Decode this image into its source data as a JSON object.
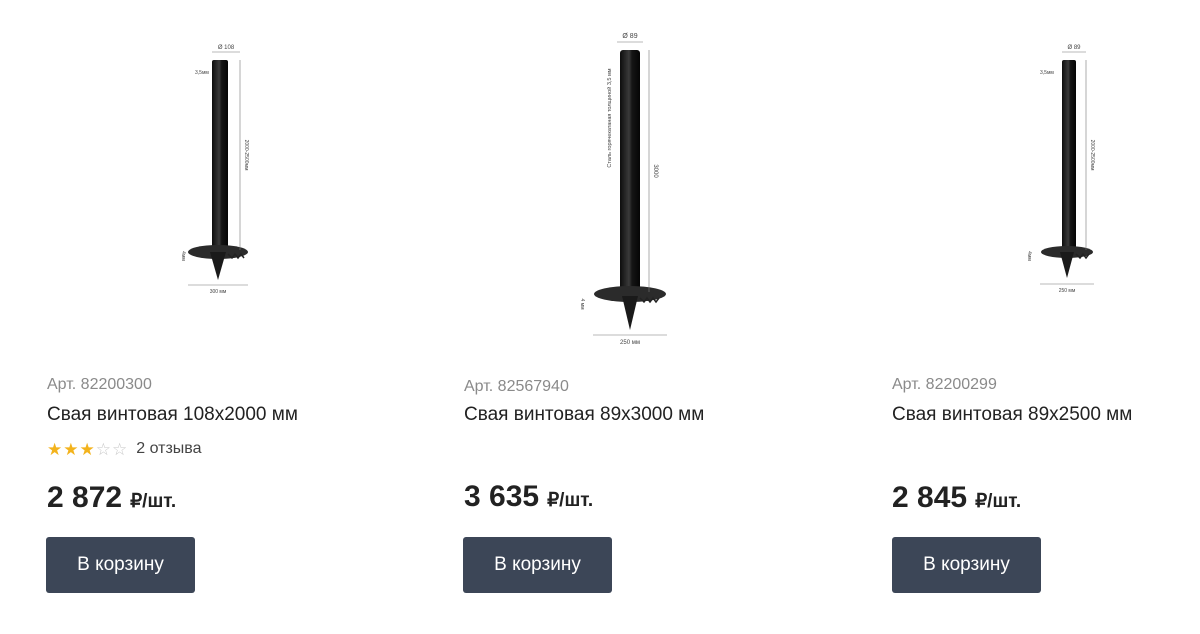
{
  "products": [
    {
      "sku": "Арт. 82200300",
      "title": "Свая винтовая 108x2000 мм",
      "rating": 3,
      "rating_max": 5,
      "reviews": "2 отзыва",
      "price": "2 872",
      "unit": "₽/шт.",
      "button": "В корзину",
      "drawing": {
        "diameter": "Ø 108",
        "wall": "3,5мм",
        "length": "2000-2500мм",
        "blade_thickness": "4мм",
        "blade_width": "300 мм"
      }
    },
    {
      "sku": "Арт. 82567940",
      "title": "Свая винтовая 89x3000 мм",
      "price": "3 635",
      "unit": "₽/шт.",
      "button": "В корзину",
      "drawing": {
        "diameter": "Ø 89",
        "wall": "Сталь горячекатаная толщиной 3,5 мм",
        "length": "3000",
        "blade_thickness": "4 мм",
        "blade_width": "250 мм"
      }
    },
    {
      "sku": "Арт. 82200299",
      "title": "Свая винтовая 89x2500 мм",
      "price": "2 845",
      "unit": "₽/шт.",
      "button": "В корзину",
      "drawing": {
        "diameter": "Ø 89",
        "wall": "3,5мм",
        "length": "2000-2500мм",
        "blade_thickness": "4мм",
        "blade_width": "250 мм"
      }
    }
  ],
  "colors": {
    "button_bg": "#3c4657",
    "star_filled": "#f3b31c",
    "star_empty": "#c9c9c9",
    "sku_text": "#8a8a8a"
  }
}
